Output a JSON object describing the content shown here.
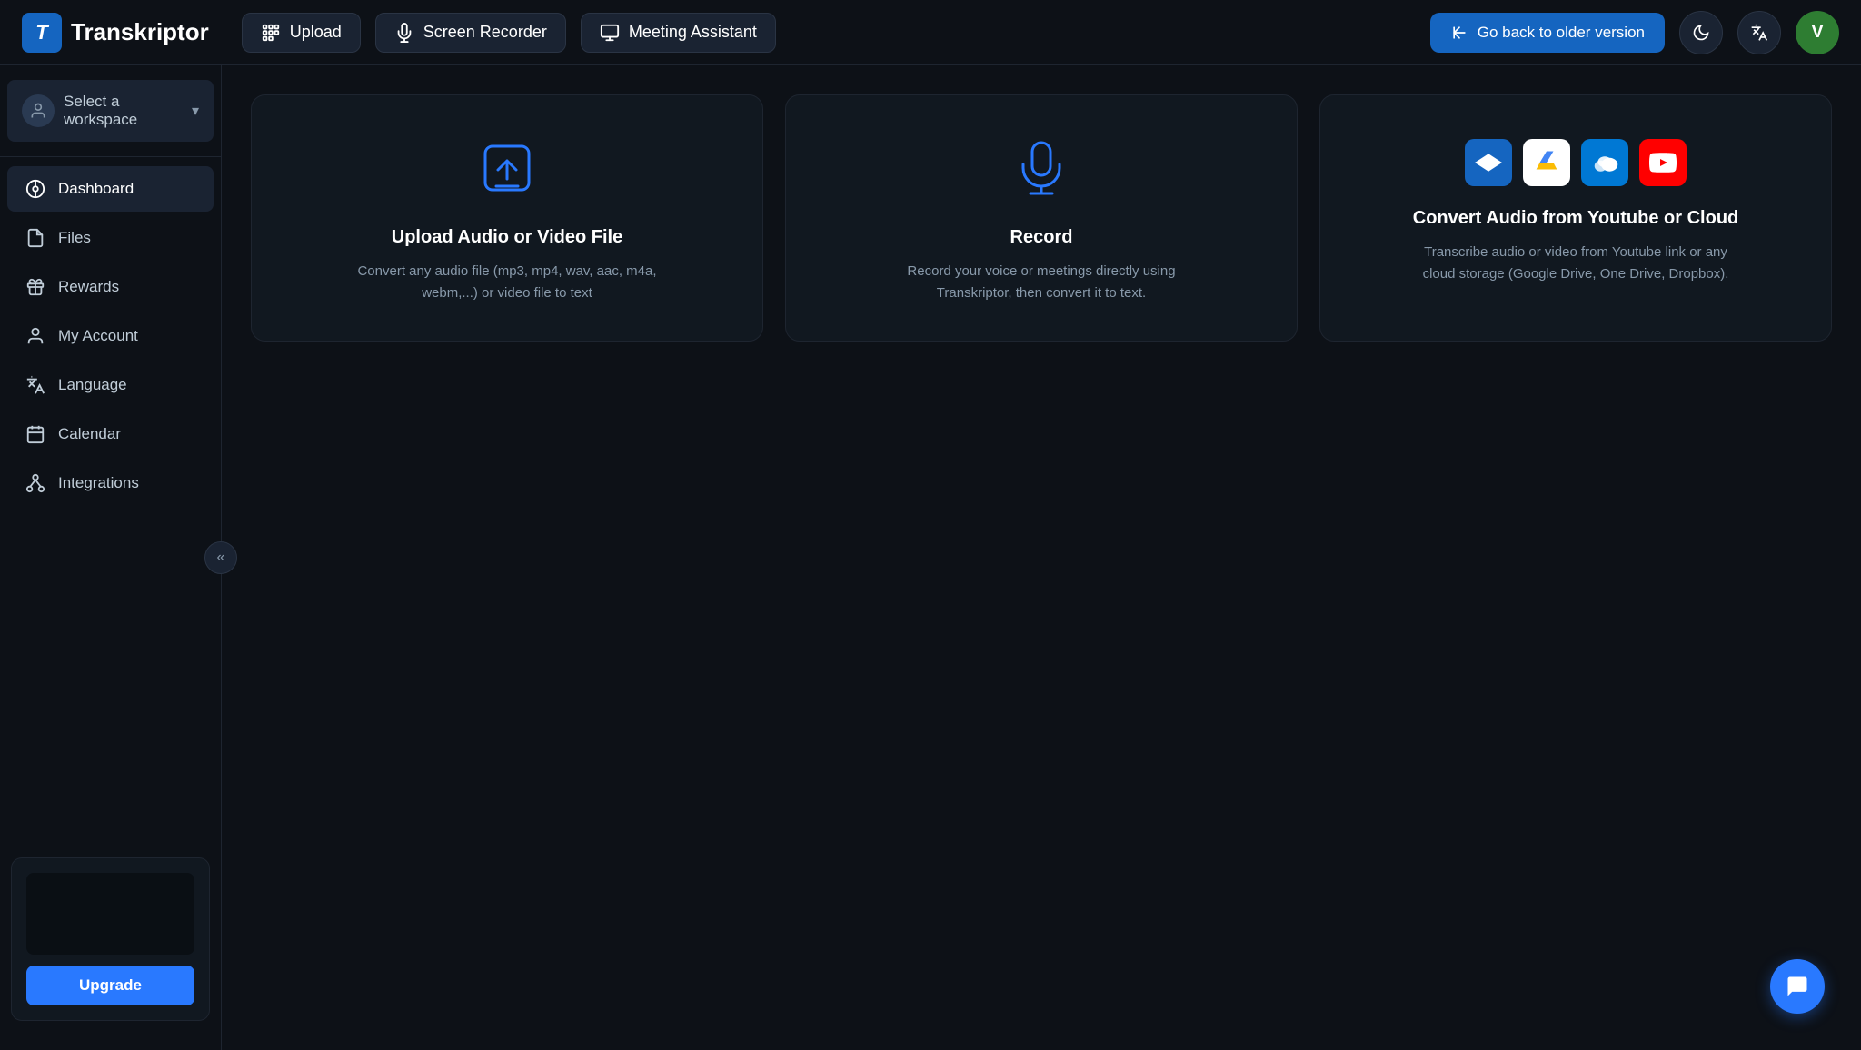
{
  "app": {
    "logo_letter": "T",
    "logo_text": "Transkriptor"
  },
  "topnav": {
    "upload_label": "Upload",
    "recorder_label": "Screen Recorder",
    "meeting_label": "Meeting Assistant",
    "go_back_label": "Go back to older version"
  },
  "sidebar": {
    "workspace_label": "Select a workspace",
    "items": [
      {
        "id": "dashboard",
        "label": "Dashboard",
        "active": true
      },
      {
        "id": "files",
        "label": "Files",
        "active": false
      },
      {
        "id": "rewards",
        "label": "Rewards",
        "active": false
      },
      {
        "id": "my-account",
        "label": "My Account",
        "active": false
      },
      {
        "id": "language",
        "label": "Language",
        "active": false
      },
      {
        "id": "calendar",
        "label": "Calendar",
        "active": false
      },
      {
        "id": "integrations",
        "label": "Integrations",
        "active": false
      }
    ],
    "upgrade_label": "Upgrade"
  },
  "main": {
    "cards": [
      {
        "id": "upload",
        "title": "Upload Audio or Video File",
        "desc": "Convert any audio file (mp3, mp4, wav, aac, m4a, webm,...) or video file to text"
      },
      {
        "id": "record",
        "title": "Record",
        "desc": "Record your voice or meetings directly using Transkriptor, then convert it to text."
      },
      {
        "id": "cloud",
        "title": "Convert Audio from Youtube or Cloud",
        "desc": "Transcribe audio or video from Youtube link or any cloud storage (Google Drive, One Drive, Dropbox)."
      }
    ]
  },
  "avatar": {
    "letter": "V"
  }
}
